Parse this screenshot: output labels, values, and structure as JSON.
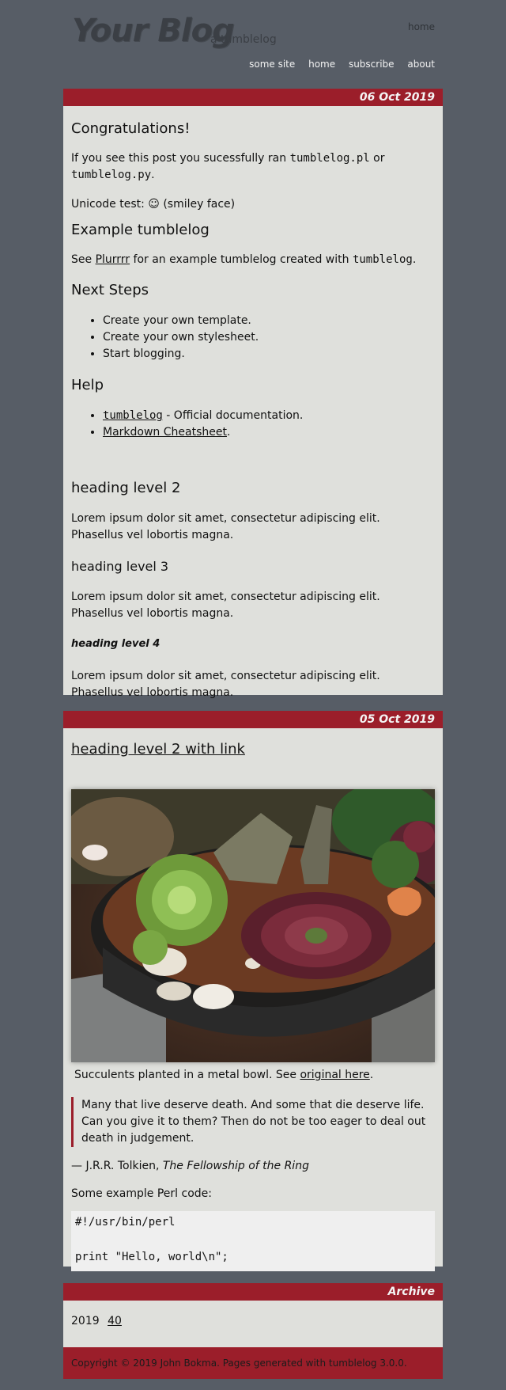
{
  "header": {
    "logo": "Your Blog",
    "tagline": "a tumblelog",
    "home_top": "home",
    "nav": [
      "some site",
      "home",
      "subscribe",
      "about"
    ]
  },
  "post1": {
    "date": "06 Oct 2019",
    "title": "Congratulations!",
    "intro_pre": "If you see this post you sucessfully ran ",
    "intro_code1": "tumblelog.pl",
    "intro_mid": " or",
    "intro_code2": "tumblelog.py",
    "intro_post": ".",
    "unicode_test": "Unicode test: ☺ (smiley face)",
    "example_heading": "Example tumblelog",
    "see_pre": "See ",
    "see_link": "Plurrrr",
    "see_mid": " for an example tumblelog created with ",
    "see_code": "tumblelog",
    "see_post": ".",
    "next_heading": "Next Steps",
    "next_steps": [
      "Create your own template.",
      "Create your own stylesheet.",
      "Start blogging."
    ],
    "help_heading": "Help",
    "help_item1_link": "tumblelog",
    "help_item1_text": " - Official documentation.",
    "help_item2_link": "Markdown Cheatsheet",
    "help_item2_text": ".",
    "h2": "heading level 2",
    "lorem": "Lorem ipsum dolor sit amet, consectetur adipiscing elit. Phasellus vel lobortis magna.",
    "h3": "heading level 3",
    "h4": "heading level 4"
  },
  "post2": {
    "date": "05 Oct 2019",
    "title": "heading level 2 with link",
    "caption_pre": "Succulents planted in a metal bowl. See ",
    "caption_link": "original here",
    "caption_post": ".",
    "quote": "Many that live deserve death. And some that die deserve life. Can you give it to them? Then do not be too eager to deal out death in judgement.",
    "attrib_pre": "— J.R.R. Tolkien, ",
    "attrib_title": "The Fellowship of the Ring",
    "code_intro": "Some example Perl code:",
    "code_line1": "#!/usr/bin/perl",
    "code_line2": "print \"Hello, world\\n\";"
  },
  "archive": {
    "heading": "Archive",
    "year": "2019",
    "week": "40"
  },
  "footer": {
    "text_pre": "Copyright © 2019 John Bokma. Pages generated with ",
    "link": "tumblelog 3.0.0",
    "text_post": "."
  },
  "colors": {
    "background": "#575d66",
    "accent": "#9b1e2a",
    "panel": "#dfe0dc"
  }
}
